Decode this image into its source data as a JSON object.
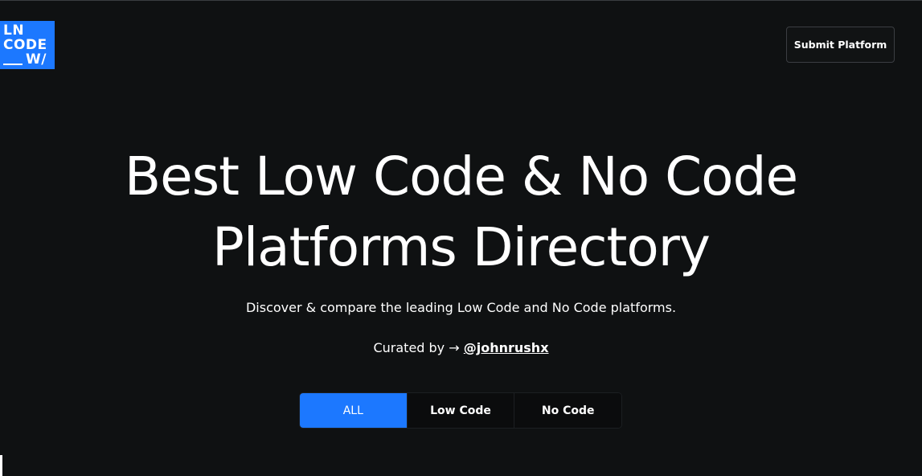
{
  "logo": {
    "line1": "LN",
    "line2": "CODE",
    "line3": "W/",
    "color": "#1c78ff"
  },
  "header": {
    "submit_label": "Submit Platform"
  },
  "hero": {
    "title_line1": "Best Low Code & No Code",
    "title_line2": "Platforms Directory",
    "subtitle": "Discover & compare the leading Low Code and No Code platforms.",
    "curated_prefix": "Curated by → ",
    "curated_handle": "@johnrushx"
  },
  "tabs": [
    {
      "label": "ALL",
      "active": true
    },
    {
      "label": "Low Code",
      "active": false
    },
    {
      "label": "No Code",
      "active": false
    }
  ],
  "colors": {
    "accent": "#1c78ff",
    "background": "#0f1112"
  }
}
